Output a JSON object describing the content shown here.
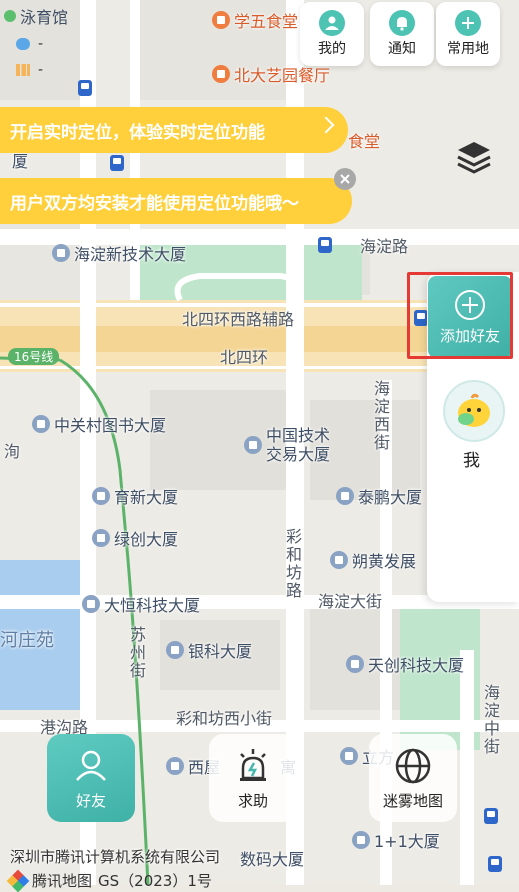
{
  "status": {
    "gym_label": "泳育馆",
    "weather_value": "-",
    "signal_value": "-"
  },
  "top_buttons": [
    {
      "label": "我的"
    },
    {
      "label": "通知"
    },
    {
      "label": "常用地"
    }
  ],
  "banners": {
    "realtime": "开启实时定位，体验实时定位功能",
    "install": "用户双方均安装才能使用定位功能哦～"
  },
  "pois": {
    "xuewu": "学五食堂",
    "yiyuan": "北大艺园餐厅",
    "canteen": "食堂",
    "haidian_tech": "海淀新技术大厦",
    "zgc_library": "中关村图书大厦",
    "china_tech": "中国技术\n交易大厦",
    "yuxin": "育新大厦",
    "taipeng": "泰鹏大厦",
    "lvchuang": "绿创大厦",
    "shuohuang": "朔黄发展",
    "daheng": "大恒科技大厦",
    "yinke": "银科大厦",
    "tianchuang": "天创科技大厦",
    "xiwu": "西屋",
    "xiwu_suffix": "寓",
    "digital": "数码大厦",
    "liyi": "1+1大厦",
    "cut_xia": "厦",
    "lifang": "立方"
  },
  "roads": {
    "haidian_road": "海淀路",
    "bsh_aux": "北四环西路辅路",
    "bsh": "北四环",
    "line16": "16号线",
    "haidian_west": "海淀西街",
    "caihefang": "彩和坊路",
    "haidian_street": "海淀大街",
    "suzhou": "苏州街",
    "gangou": "港沟路",
    "caihefang_west": "彩和坊西小街",
    "haidian_middle": "海淀中街",
    "hezhuangyuan": "河庄苑",
    "xun": "洵"
  },
  "side": {
    "add_friend_label": "添加好友",
    "me_label": "我"
  },
  "bottom": {
    "friends_label": "好友",
    "help_label": "求助",
    "fog_label": "迷雾地图"
  },
  "copyright": {
    "company": "深圳市腾讯计算机系统有限公司",
    "brand": "腾讯地图",
    "gs": "GS（2023）1号"
  },
  "colors": {
    "accent": "#4cc3b3",
    "banner": "#ffd03c",
    "highlight": "#e53935"
  }
}
